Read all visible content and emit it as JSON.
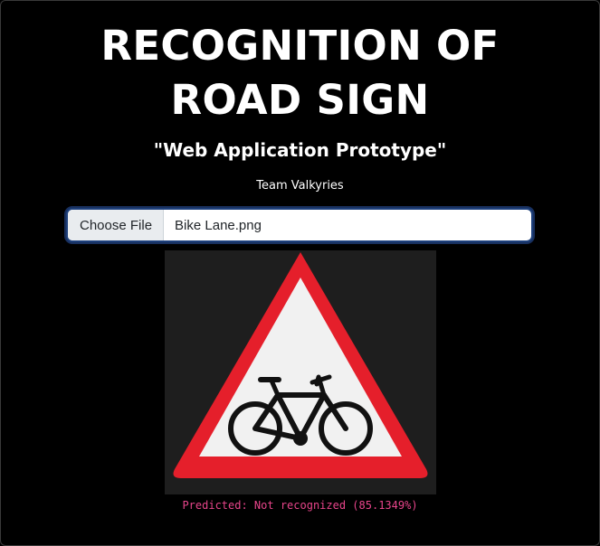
{
  "header": {
    "title_line1": "RECOGNITION OF",
    "title_line2": "ROAD SIGN",
    "subtitle": "\"Web Application Prototype\"",
    "team": "Team Valkyries"
  },
  "file_input": {
    "button_label": "Choose File",
    "file_name": "Bike Lane.png"
  },
  "preview": {
    "icon": "bicycle-warning-sign",
    "border_color": "#e51f2b",
    "fill_color": "#f1f1f1",
    "symbol_color": "#111111"
  },
  "result": {
    "prediction": "Predicted: Not recognized (85.1349%)",
    "color": "#e8458b"
  }
}
